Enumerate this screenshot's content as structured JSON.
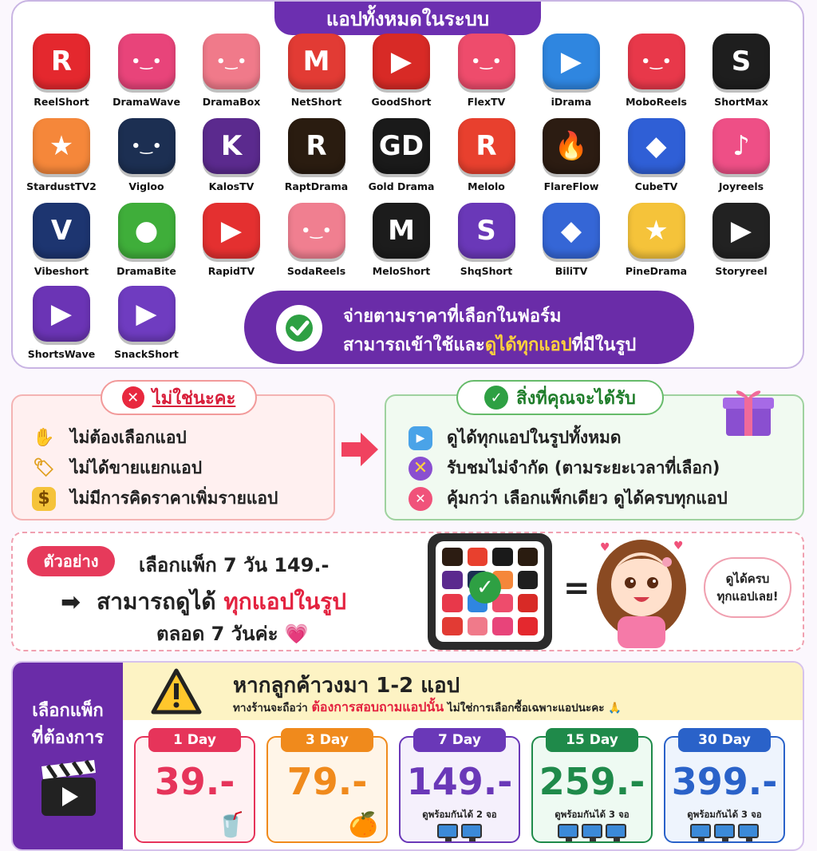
{
  "apps_section": {
    "title": "แอปทั้งหมดในระบบ",
    "apps": [
      {
        "name": "ReelShort",
        "glyph": "R",
        "color": "#e4282e"
      },
      {
        "name": "DramaWave",
        "glyph": "•‿•",
        "color": "#e8447a"
      },
      {
        "name": "DramaBox",
        "glyph": "•‿•",
        "color": "#f07a8a"
      },
      {
        "name": "NetShort",
        "glyph": "M",
        "color": "#e23b34"
      },
      {
        "name": "GoodShort",
        "glyph": "▶",
        "color": "#d82a26"
      },
      {
        "name": "FlexTV",
        "glyph": "•‿•",
        "color": "#ee4c6c"
      },
      {
        "name": "iDrama",
        "glyph": "▶",
        "color": "#2f86e0"
      },
      {
        "name": "MoboReels",
        "glyph": "•‿•",
        "color": "#e8384a"
      },
      {
        "name": "ShortMax",
        "glyph": "S",
        "color": "#1e1e1e"
      },
      {
        "name": "StardustTV2",
        "glyph": "★",
        "color": "#f5873a"
      },
      {
        "name": "Vigloo",
        "glyph": "•‿•",
        "color": "#1c2f52"
      },
      {
        "name": "KalosTV",
        "glyph": "K",
        "color": "#5b2a8e"
      },
      {
        "name": "RaptDrama",
        "glyph": "R",
        "color": "#2a1c10"
      },
      {
        "name": "Gold Drama",
        "glyph": "GD",
        "color": "#1a1a1a"
      },
      {
        "name": "Melolo",
        "glyph": "R",
        "color": "#e8402e"
      },
      {
        "name": "FlareFlow",
        "glyph": "🔥",
        "color": "#2c1c12"
      },
      {
        "name": "CubeTV",
        "glyph": "◆",
        "color": "#2f5fd6"
      },
      {
        "name": "Joyreels",
        "glyph": "♪",
        "color": "#ee4f86"
      },
      {
        "name": "Vibeshort",
        "glyph": "V",
        "color": "#1d3570"
      },
      {
        "name": "DramaBite",
        "glyph": "●",
        "color": "#3fae3a"
      },
      {
        "name": "RapidTV",
        "glyph": "▶",
        "color": "#e43030"
      },
      {
        "name": "SodaReels",
        "glyph": "•‿•",
        "color": "#f07f90"
      },
      {
        "name": "MeloShort",
        "glyph": "M",
        "color": "#1c1c1c"
      },
      {
        "name": "ShqShort",
        "glyph": "S",
        "color": "#6a38b8"
      },
      {
        "name": "BiliTV",
        "glyph": "◆",
        "color": "#3566d6"
      },
      {
        "name": "PineDrama",
        "glyph": "★",
        "color": "#f5c33a"
      },
      {
        "name": "Storyreel",
        "glyph": "▶",
        "color": "#222222"
      },
      {
        "name": "ShortsWave",
        "glyph": "▶",
        "color": "#6b34b5"
      },
      {
        "name": "SnackShort",
        "glyph": "▶",
        "color": "#6f3cc0"
      }
    ],
    "pay_line1": "จ่ายตามราคาที่เลือกในฟอร์ม",
    "pay_line2_a": "สามารถเข้าใช้และ",
    "pay_line2_b": "ดูได้ทุกแอป",
    "pay_line2_c": "ที่มีในรูป"
  },
  "not_section": {
    "title": "ไม่ใช่นะคะ",
    "items": [
      "ไม่ต้องเลือกแอป",
      "ไม่ได้ขายแยกแอป",
      "ไม่มีการคิดราคาเพิ่มรายแอป"
    ]
  },
  "get_section": {
    "title": "สิ่งที่คุณจะได้รับ",
    "items": [
      "ดูได้ทุกแอปในรูปทั้งหมด",
      "รับชมไม่จำกัด (ตามระยะเวลาที่เลือก)",
      "คุ้มกว่า เลือกแพ็กเดียว ดูได้ครบทุกแอป"
    ]
  },
  "example": {
    "badge": "ตัวอย่าง",
    "line1": "เลือกแพ็ก 7 วัน 149.-",
    "line2_a": "สามารถดูได้",
    "line2_b": "ทุกแอปในรูป",
    "line3": "ตลอด 7 วันค่ะ 💗",
    "equals": "=",
    "bubble_l1": "ดูได้ครบ",
    "bubble_l2": "ทุกแอปเลย!"
  },
  "packages": {
    "side_title_l1": "เลือกแพ็ก",
    "side_title_l2": "ที่ต้องการ",
    "warn_l1": "หากลูกค้าวงมา 1-2 แอป",
    "warn_l2_a": "ทางร้านจะถือว่า ",
    "warn_l2_b": "ต้องการสอบถามแอปนั้น",
    "warn_l2_c": " ไม่ใช่การเลือกซื้อเฉพาะแอปนะคะ 🙏",
    "cards": [
      {
        "day": "1 Day",
        "price": "39.-",
        "note": "",
        "screens": 0,
        "color": "#e6345a",
        "bg": "#fff1f3"
      },
      {
        "day": "3 Day",
        "price": "79.-",
        "note": "",
        "screens": 0,
        "color": "#f08a1c",
        "bg": "#fff5e8"
      },
      {
        "day": "7 Day",
        "price": "149.-",
        "note": "ดูพร้อมกันได้ 2 จอ",
        "screens": 2,
        "color": "#6a38b8",
        "bg": "#f5f0fc"
      },
      {
        "day": "15 Day",
        "price": "259.-",
        "note": "ดูพร้อมกันได้ 3 จอ",
        "screens": 3,
        "color": "#1f8a4a",
        "bg": "#eefaf2"
      },
      {
        "day": "30 Day",
        "price": "399.-",
        "note": "ดูพร้อมกันได้ 3 จอ",
        "screens": 3,
        "color": "#2a62c9",
        "bg": "#eef4fd"
      }
    ]
  },
  "colors": {
    "purple": "#6a2ca8",
    "red": "#e3223f",
    "green": "#2ea043",
    "yellow": "#ffd23c"
  }
}
